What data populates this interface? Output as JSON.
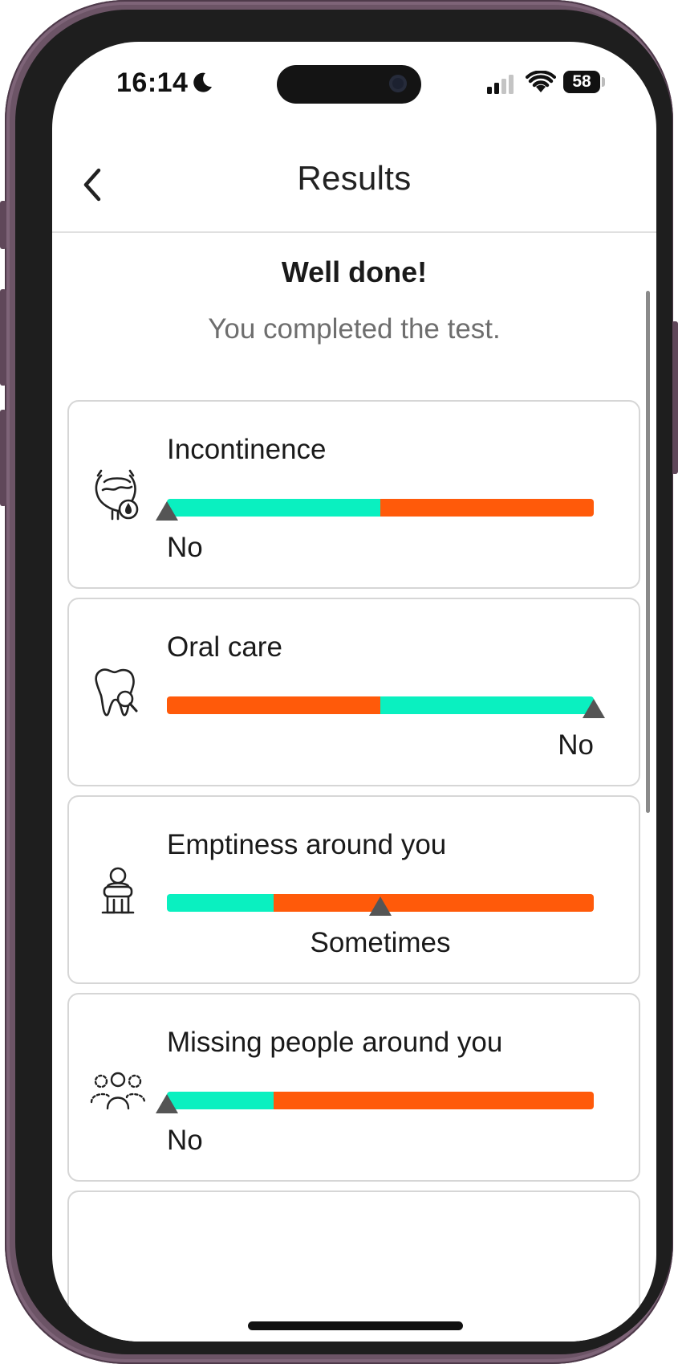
{
  "status_bar": {
    "time": "16:14",
    "battery": "58",
    "icons": [
      "moon-icon",
      "signal-icon",
      "wifi-icon",
      "battery-icon"
    ]
  },
  "header": {
    "back_icon": "chevron-left-icon",
    "title": "Results"
  },
  "summary": {
    "heading": "Well done!",
    "subtitle": "You completed the test."
  },
  "colors": {
    "good": "#0af0c0",
    "bad": "#ff5a0a",
    "marker": "#555555"
  },
  "results": [
    {
      "title": "Incontinence",
      "icon": "bladder-drop-icon",
      "answer": "No",
      "segments": [
        {
          "status": "good",
          "fraction": 0.5
        },
        {
          "status": "bad",
          "fraction": 0.5
        }
      ],
      "marker_position": 0.0
    },
    {
      "title": "Oral care",
      "icon": "tooth-search-icon",
      "answer": "No",
      "segments": [
        {
          "status": "bad",
          "fraction": 0.5
        },
        {
          "status": "good",
          "fraction": 0.5
        }
      ],
      "marker_position": 1.0
    },
    {
      "title": "Emptiness around you",
      "icon": "lonely-person-icon",
      "answer": "Sometimes",
      "segments": [
        {
          "status": "good",
          "fraction": 0.25
        },
        {
          "status": "bad",
          "fraction": 0.75
        }
      ],
      "marker_position": 0.5
    },
    {
      "title": "Missing people around you",
      "icon": "missing-people-icon",
      "answer": "No",
      "segments": [
        {
          "status": "good",
          "fraction": 0.25
        },
        {
          "status": "bad",
          "fraction": 0.75
        }
      ],
      "marker_position": 0.0
    }
  ]
}
